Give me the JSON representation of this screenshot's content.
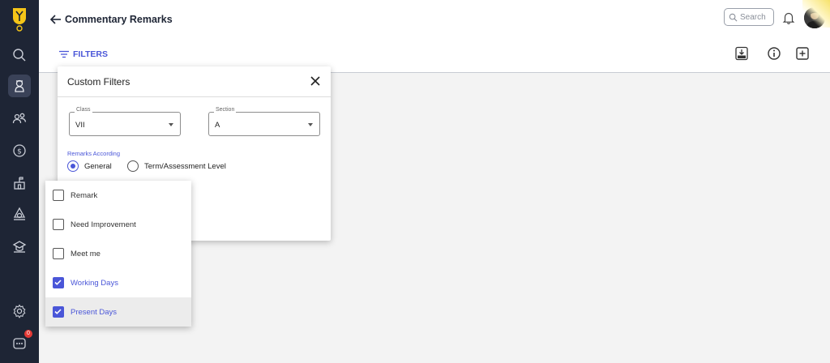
{
  "header": {
    "title": "Commentary Remarks",
    "search_placeholder": "Search"
  },
  "toolbar": {
    "filters_label": "FILTERS",
    "icons": [
      "excel-download-icon",
      "info-icon",
      "add-icon"
    ]
  },
  "sidebar": {
    "items": [
      "search-icon",
      "student-icon",
      "users-icon",
      "dollar-icon",
      "school-icon",
      "award-icon",
      "graduation-icon",
      "settings-icon",
      "chat-icon"
    ],
    "chat_badge": "0"
  },
  "dialog": {
    "title": "Custom Filters",
    "class": {
      "label": "Class",
      "value": "VII"
    },
    "section": {
      "label": "Section",
      "value": "A"
    },
    "remarks_according_label": "Remarks According",
    "radio_options": [
      {
        "label": "General",
        "selected": true
      },
      {
        "label": "Term/Assessment Level",
        "selected": false
      }
    ]
  },
  "dropdown": {
    "options": [
      {
        "label": "Remark",
        "checked": false
      },
      {
        "label": "Need Improvement",
        "checked": false
      },
      {
        "label": "Meet me",
        "checked": false
      },
      {
        "label": "Working Days",
        "checked": true
      },
      {
        "label": "Present Days",
        "checked": true
      }
    ]
  },
  "colors": {
    "sidebar": "#1e2535",
    "accent": "#4a56d8",
    "logo": "#f5c518"
  }
}
